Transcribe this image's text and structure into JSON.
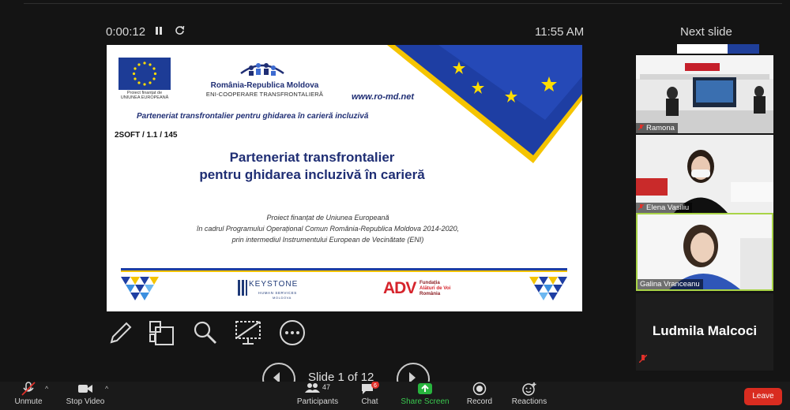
{
  "session": {
    "elapsed": "0:00:12",
    "clock": "11:55 AM",
    "next_slide_label": "Next slide"
  },
  "slide": {
    "eu_caption_1": "Proiect finanțat de",
    "eu_caption_2": "UNIUNEA EUROPEANĂ",
    "program_title": "România-Republica Moldova",
    "program_subtitle": "ENI-COOPERARE TRANSFRONTALIERĂ",
    "url": "www.ro-md.net",
    "project_line": "Parteneriat transfrontalier pentru ghidarea în carieră incluzivă",
    "code": "2SOFT / 1.1 / 145",
    "title_line1": "Parteneriat transfrontalier",
    "title_line2": "pentru ghidarea incluzivă în carieră",
    "desc_line1": "Proiect finanțat de Uniunea Europeană",
    "desc_line2": "în cadrul Programului Operațional Comun România-Republica Moldova 2014-2020,",
    "desc_line3": "prin intermediul Instrumentului European de Vecinătate (ENI)",
    "keystone": "KEYSTONE",
    "keystone_sub": "HUMAN SERVICES",
    "keystone_sub2": "MOLDOVA",
    "adv": "ADV",
    "adv_t1": "Fundația",
    "adv_t2": "Alături de Voi",
    "adv_t3": "România"
  },
  "slide_nav": {
    "label": "Slide 1 of 12"
  },
  "participants_panel": [
    {
      "name": "Ramona",
      "muted": true
    },
    {
      "name": "Elena Vasiliu",
      "muted": true
    },
    {
      "name": "Galina Vranceanu",
      "muted": false
    }
  ],
  "active_speaker": {
    "name": "Ludmila Malcoci",
    "muted": true
  },
  "toolbar": {
    "unmute": "Unmute",
    "stop_video": "Stop Video",
    "participants": "Participants",
    "participants_count": "47",
    "chat": "Chat",
    "chat_badge": "6",
    "share_screen": "Share Screen",
    "record": "Record",
    "reactions": "Reactions",
    "leave": "Leave"
  },
  "colors": {
    "slide_blue": "#1f2e74",
    "eu_blue": "#1d3c96",
    "eu_star": "#ffdd00",
    "share_green": "#28b53e",
    "leave_red": "#d92c20",
    "badge_red": "#e0312a"
  }
}
